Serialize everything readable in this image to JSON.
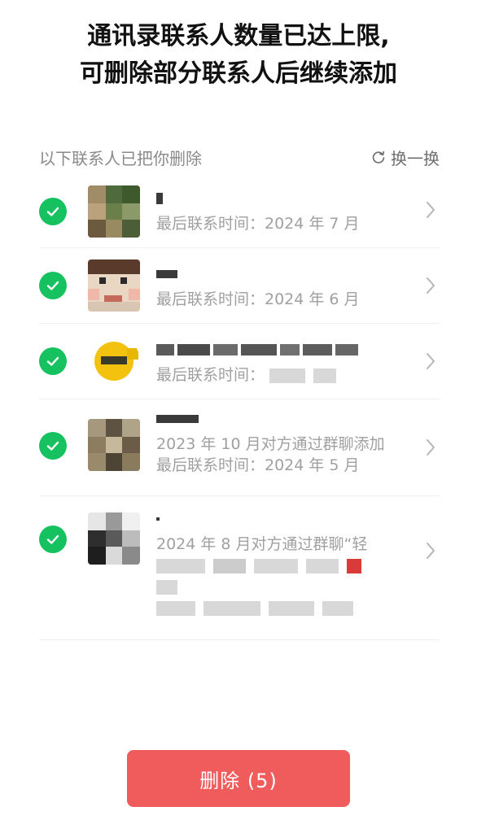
{
  "header": {
    "title_line1": "通讯录联系人数量已达上限,",
    "title_line2": "可删除部分联系人后继续添加"
  },
  "subheader": {
    "label": "以下联系人已把你删除",
    "refresh_label": "换一换"
  },
  "contacts": [
    {
      "checked": true,
      "line1": "最后联系时间：2024 年 7 月",
      "line2": ""
    },
    {
      "checked": true,
      "line1": "最后联系时间：2024 年 6 月",
      "line2": ""
    },
    {
      "checked": true,
      "line1": "最后联系时间：",
      "line2": ""
    },
    {
      "checked": true,
      "line1": "2023 年 10 月对方通过群聊添加",
      "line2": "最后联系时间：2024 年 5 月"
    },
    {
      "checked": true,
      "line1": "2024 年 8 月对方通过群聊“轻",
      "line2": ""
    }
  ],
  "footer": {
    "delete_label": "删除 (5)"
  },
  "colors": {
    "accent_green": "#16c160",
    "delete_red": "#f05b5b"
  }
}
